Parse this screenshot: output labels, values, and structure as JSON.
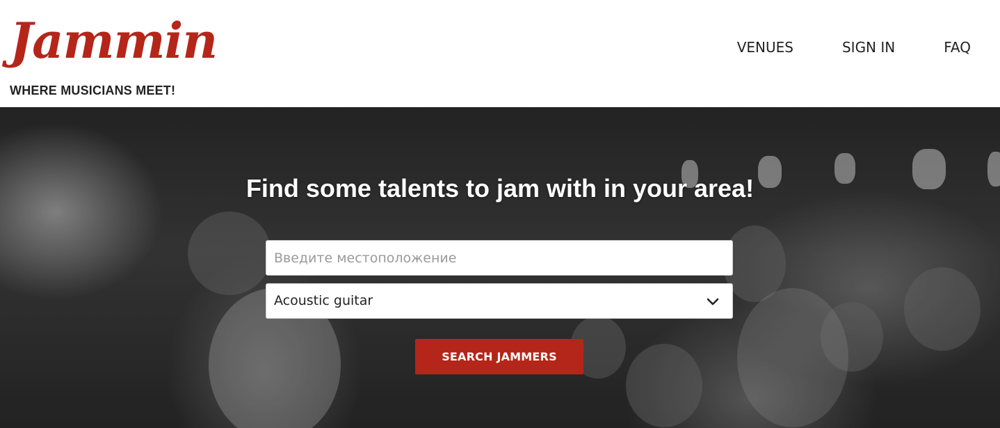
{
  "brand": {
    "logo_text": "Jammin",
    "tagline": "WHERE MUSICIANS MEET!",
    "logo_color": "#b5261a"
  },
  "nav": {
    "items": [
      {
        "label": "VENUES"
      },
      {
        "label": "SIGN IN"
      },
      {
        "label": "FAQ"
      }
    ]
  },
  "hero": {
    "title": "Find some talents to jam with in your area!",
    "background": "black-and-white concert crowd photo"
  },
  "search": {
    "location_value": "",
    "location_placeholder": "Введите местоположение",
    "instrument_selected": "Acoustic guitar",
    "button_label": "SEARCH JAMMERS",
    "button_color": "#b5261a"
  },
  "icons": {
    "dropdown": "chevron-down-icon"
  }
}
